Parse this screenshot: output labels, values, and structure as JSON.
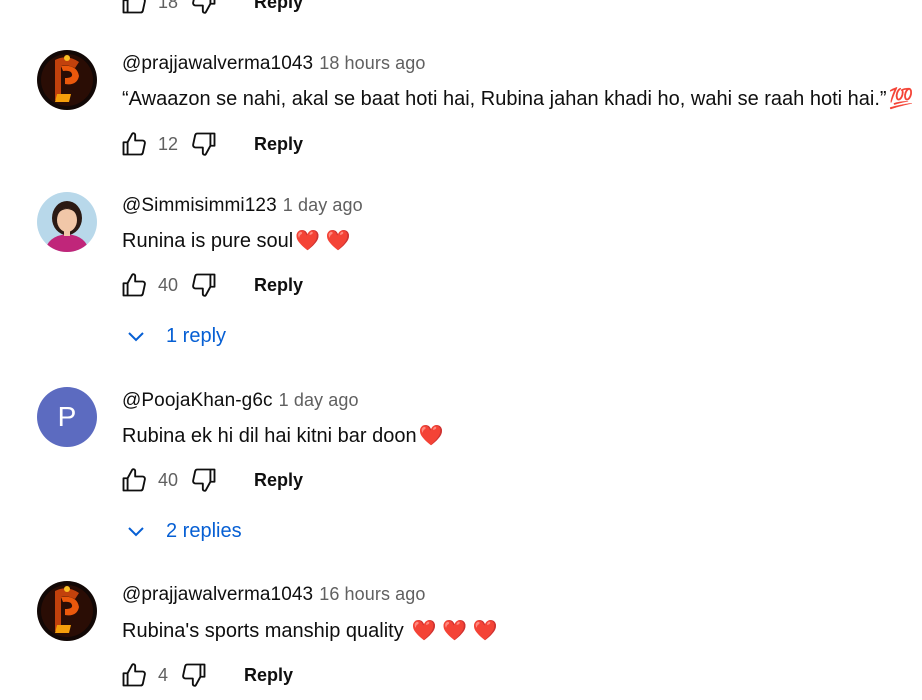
{
  "top_partial": {
    "likes": "18",
    "reply_label": "Reply"
  },
  "comments": [
    {
      "handle": "@prajjawalverma1043",
      "time": "18 hours ago",
      "text": "“Awaazon se nahi, akal se baat hoti hai, Rubina jahan khadi ho, wahi se raah hoti hai.”",
      "emoji": "💯",
      "likes": "12",
      "reply_label": "Reply"
    },
    {
      "handle": "@Simmisimmi123",
      "time": "1 day ago",
      "text": "Runina is pure soul",
      "emoji": "❤️ ❤️",
      "likes": "40",
      "reply_label": "Reply",
      "replies_label": "1 reply"
    },
    {
      "handle": "@PoojaKhan-g6c",
      "avatar_letter": "P",
      "time": "1 day ago",
      "text": "Rubina ek hi dil hai kitni bar doon",
      "emoji": "❤️",
      "likes": "40",
      "reply_label": "Reply",
      "replies_label": "2 replies"
    },
    {
      "handle": "@prajjawalverma1043",
      "time": "16 hours ago",
      "text": "Rubina's sports manship quality",
      "emoji": "❤️ ❤️ ❤️",
      "likes": "4",
      "reply_label": "Reply"
    }
  ],
  "colors": {
    "link": "#065fd4",
    "secondary_text": "#606060",
    "heart": "#e0242c",
    "avatar_p": "#5c6bc0"
  },
  "icons": {
    "like": "thumbs-up-icon",
    "dislike": "thumbs-down-icon",
    "expand": "chevron-down-icon"
  }
}
